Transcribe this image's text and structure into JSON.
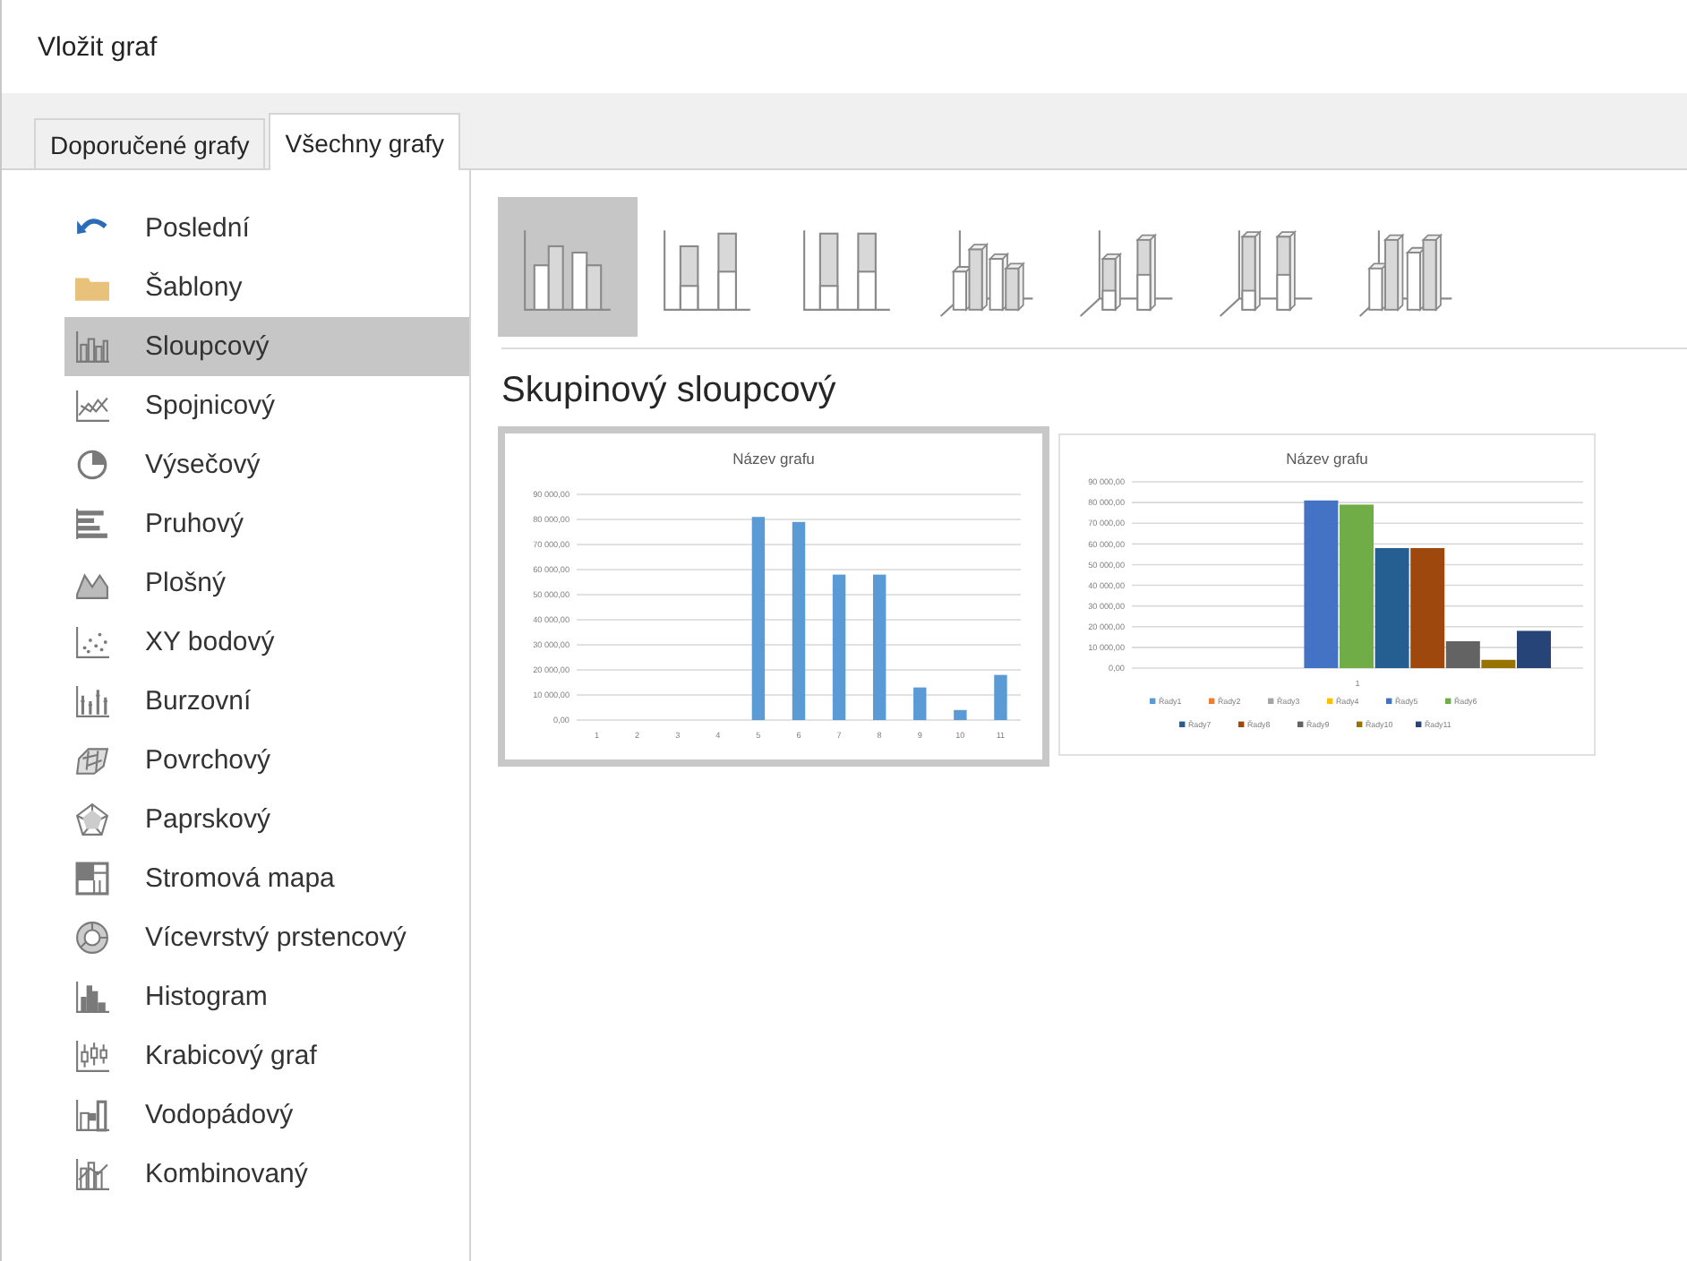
{
  "window": {
    "title": "Vložit graf"
  },
  "tabs": [
    {
      "label": "Doporučené grafy",
      "selected": false
    },
    {
      "label": "Všechny grafy",
      "selected": true
    }
  ],
  "sidebar": {
    "items": [
      {
        "label": "Poslední",
        "selected": false
      },
      {
        "label": "Šablony",
        "selected": false
      },
      {
        "label": "Sloupcový",
        "selected": true
      },
      {
        "label": "Spojnicový",
        "selected": false
      },
      {
        "label": "Výsečový",
        "selected": false
      },
      {
        "label": "Pruhový",
        "selected": false
      },
      {
        "label": "Plošný",
        "selected": false
      },
      {
        "label": "XY bodový",
        "selected": false
      },
      {
        "label": "Burzovní",
        "selected": false
      },
      {
        "label": "Povrchový",
        "selected": false
      },
      {
        "label": "Paprskový",
        "selected": false
      },
      {
        "label": "Stromová mapa",
        "selected": false
      },
      {
        "label": "Vícevrstvý prstencový",
        "selected": false
      },
      {
        "label": "Histogram",
        "selected": false
      },
      {
        "label": "Krabicový graf",
        "selected": false
      },
      {
        "label": "Vodopádový",
        "selected": false
      },
      {
        "label": "Kombinovaný",
        "selected": false
      }
    ]
  },
  "chart_types": [
    {
      "selected": true
    },
    {
      "selected": false
    },
    {
      "selected": false
    },
    {
      "selected": false
    },
    {
      "selected": false
    },
    {
      "selected": false
    },
    {
      "selected": false
    }
  ],
  "subtype_title": "Skupinový sloupcový",
  "previews": [
    {
      "selected": true,
      "chart_data": {
        "type": "bar",
        "title": "Název grafu",
        "categories": [
          "1",
          "2",
          "3",
          "4",
          "5",
          "6",
          "7",
          "8",
          "9",
          "10",
          "11"
        ],
        "values": [
          0,
          0,
          0,
          0,
          81000,
          79000,
          58000,
          58000,
          13000,
          4000,
          18000
        ],
        "grid": true,
        "ylim": [
          0,
          90000
        ],
        "yticks": [
          {
            "value": 0,
            "label": "0,00"
          },
          {
            "value": 10000,
            "label": "10 000,00"
          },
          {
            "value": 20000,
            "label": "20 000,00"
          },
          {
            "value": 30000,
            "label": "30 000,00"
          },
          {
            "value": 40000,
            "label": "40 000,00"
          },
          {
            "value": 50000,
            "label": "50 000,00"
          },
          {
            "value": 60000,
            "label": "60 000,00"
          },
          {
            "value": 70000,
            "label": "70 000,00"
          },
          {
            "value": 80000,
            "label": "80 000,00"
          },
          {
            "value": 90000,
            "label": "90 000,00"
          }
        ]
      }
    },
    {
      "selected": false,
      "chart_data": {
        "type": "bar",
        "title": "Název grafu",
        "categories": [
          "1"
        ],
        "series": [
          {
            "name": "Řady1",
            "color": "#5b9bd5",
            "values": [
              0
            ]
          },
          {
            "name": "Řady2",
            "color": "#ed7d31",
            "values": [
              0
            ]
          },
          {
            "name": "Řady3",
            "color": "#a5a5a5",
            "values": [
              0
            ]
          },
          {
            "name": "Řady4",
            "color": "#ffc000",
            "values": [
              0
            ]
          },
          {
            "name": "Řady5",
            "color": "#4472c4",
            "values": [
              81000
            ]
          },
          {
            "name": "Řady6",
            "color": "#70ad47",
            "values": [
              79000
            ]
          },
          {
            "name": "Řady7",
            "color": "#255e91",
            "values": [
              58000
            ]
          },
          {
            "name": "Řady8",
            "color": "#9e480e",
            "values": [
              58000
            ]
          },
          {
            "name": "Řady9",
            "color": "#636363",
            "values": [
              13000
            ]
          },
          {
            "name": "Řady10",
            "color": "#997300",
            "values": [
              4000
            ]
          },
          {
            "name": "Řady11",
            "color": "#264478",
            "values": [
              18000
            ]
          }
        ],
        "grid": true,
        "legend": true,
        "ylim": [
          0,
          90000
        ],
        "yticks": [
          {
            "value": 0,
            "label": "0,00"
          },
          {
            "value": 10000,
            "label": "10 000,00"
          },
          {
            "value": 20000,
            "label": "20 000,00"
          },
          {
            "value": 30000,
            "label": "30 000,00"
          },
          {
            "value": 40000,
            "label": "40 000,00"
          },
          {
            "value": 50000,
            "label": "50 000,00"
          },
          {
            "value": 60000,
            "label": "60 000,00"
          },
          {
            "value": 70000,
            "label": "70 000,00"
          },
          {
            "value": 80000,
            "label": "80 000,00"
          },
          {
            "value": 90000,
            "label": "90 000,00"
          }
        ]
      }
    }
  ]
}
